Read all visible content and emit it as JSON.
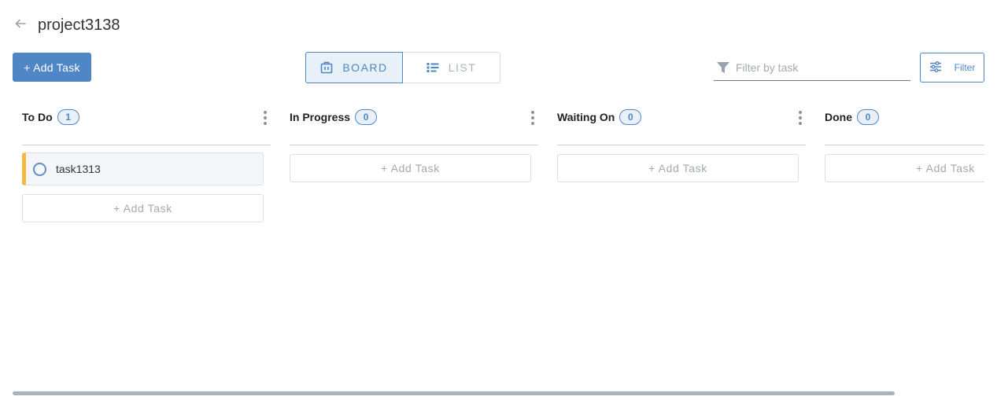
{
  "header": {
    "title": "project3138",
    "back_icon": "arrow-left-icon"
  },
  "toolbar": {
    "add_task_label": "+ Add Task",
    "view_board_label": "BOARD",
    "view_list_label": "LIST",
    "filter_placeholder": "Filter by task",
    "filter_value": "",
    "filter_button_label": "Filter"
  },
  "columns": [
    {
      "title": "To Do",
      "count": "1",
      "tasks": [
        {
          "name": "task1313",
          "priority_color": "#f5b942"
        }
      ],
      "add_label": "+ Add Task"
    },
    {
      "title": "In Progress",
      "count": "0",
      "tasks": [],
      "add_label": "+ Add Task"
    },
    {
      "title": "Waiting On",
      "count": "0",
      "tasks": [],
      "add_label": "+ Add Task"
    },
    {
      "title": "Done",
      "count": "0",
      "tasks": [],
      "add_label": "+ Add Task"
    }
  ],
  "colors": {
    "accent": "#4f86c6",
    "task_priority": "#f5b942",
    "muted_text": "#a3aab2"
  }
}
